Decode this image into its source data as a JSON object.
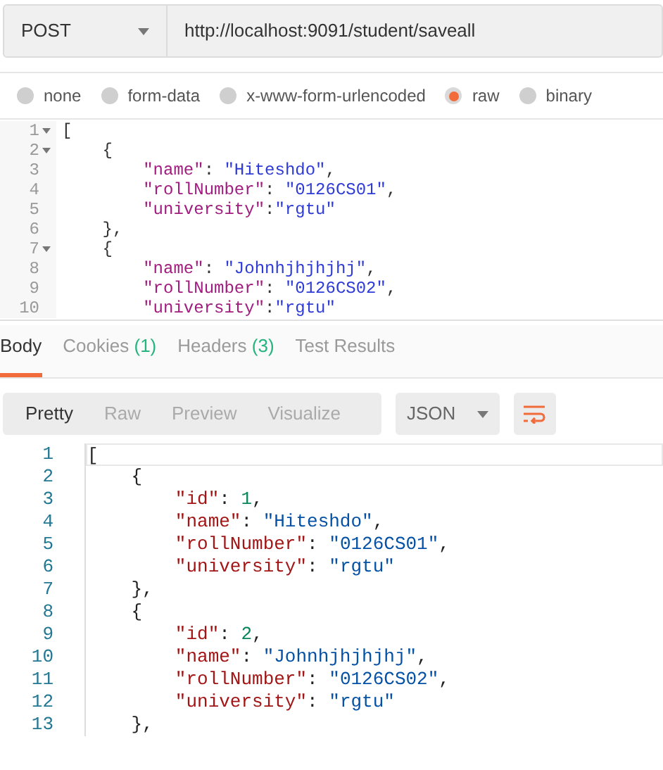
{
  "request": {
    "method": "POST",
    "url": "http://localhost:9091/student/saveall"
  },
  "body_types": [
    {
      "label": "none",
      "selected": false
    },
    {
      "label": "form-data",
      "selected": false
    },
    {
      "label": "x-www-form-urlencoded",
      "selected": false
    },
    {
      "label": "raw",
      "selected": true
    },
    {
      "label": "binary",
      "selected": false
    }
  ],
  "request_body": [
    {
      "number": "1",
      "fold": true,
      "tokens": [
        {
          "kind": "punct",
          "text": "["
        }
      ]
    },
    {
      "number": "2",
      "fold": true,
      "tokens": [
        {
          "kind": "punct",
          "text": "    {"
        }
      ]
    },
    {
      "number": "3",
      "fold": false,
      "tokens": [
        {
          "kind": "key",
          "text": "        \"name\""
        },
        {
          "kind": "punct",
          "text": ": "
        },
        {
          "kind": "string",
          "text": "\"Hiteshdo\""
        },
        {
          "kind": "punct",
          "text": ","
        }
      ]
    },
    {
      "number": "4",
      "fold": false,
      "tokens": [
        {
          "kind": "key",
          "text": "        \"rollNumber\""
        },
        {
          "kind": "punct",
          "text": ": "
        },
        {
          "kind": "string",
          "text": "\"0126CS01\""
        },
        {
          "kind": "punct",
          "text": ","
        }
      ]
    },
    {
      "number": "5",
      "fold": false,
      "tokens": [
        {
          "kind": "key",
          "text": "        \"university\""
        },
        {
          "kind": "punct",
          "text": ":"
        },
        {
          "kind": "string",
          "text": "\"rgtu\""
        }
      ]
    },
    {
      "number": "6",
      "fold": false,
      "tokens": [
        {
          "kind": "punct",
          "text": "    },"
        }
      ]
    },
    {
      "number": "7",
      "fold": true,
      "tokens": [
        {
          "kind": "punct",
          "text": "    {"
        }
      ]
    },
    {
      "number": "8",
      "fold": false,
      "tokens": [
        {
          "kind": "key",
          "text": "        \"name\""
        },
        {
          "kind": "punct",
          "text": ": "
        },
        {
          "kind": "string",
          "text": "\"Johnhjhjhjhj\""
        },
        {
          "kind": "punct",
          "text": ","
        }
      ]
    },
    {
      "number": "9",
      "fold": false,
      "tokens": [
        {
          "kind": "key",
          "text": "        \"rollNumber\""
        },
        {
          "kind": "punct",
          "text": ": "
        },
        {
          "kind": "string",
          "text": "\"0126CS02\""
        },
        {
          "kind": "punct",
          "text": ","
        }
      ]
    },
    {
      "number": "10",
      "fold": false,
      "tokens": [
        {
          "kind": "key",
          "text": "        \"university\""
        },
        {
          "kind": "punct",
          "text": ":"
        },
        {
          "kind": "string",
          "text": "\"rgtu\""
        }
      ]
    }
  ],
  "response_tabs": [
    {
      "label": "Body",
      "selected": true
    },
    {
      "label": "Cookies",
      "count": "(1)",
      "selected": false
    },
    {
      "label": "Headers",
      "count": "(3)",
      "selected": false
    },
    {
      "label": "Test Results",
      "selected": false
    }
  ],
  "view_modes": [
    {
      "label": "Pretty",
      "selected": true
    },
    {
      "label": "Raw",
      "selected": false
    },
    {
      "label": "Preview",
      "selected": false
    },
    {
      "label": "Visualize",
      "selected": false
    }
  ],
  "format": "JSON",
  "response_body": [
    {
      "number": "1",
      "tokens": [
        {
          "kind": "punct",
          "text": "["
        }
      ]
    },
    {
      "number": "2",
      "tokens": [
        {
          "kind": "punct",
          "text": "    {"
        }
      ]
    },
    {
      "number": "3",
      "tokens": [
        {
          "kind": "key",
          "text": "        \"id\""
        },
        {
          "kind": "punct",
          "text": ": "
        },
        {
          "kind": "number",
          "text": "1"
        },
        {
          "kind": "punct",
          "text": ","
        }
      ]
    },
    {
      "number": "4",
      "tokens": [
        {
          "kind": "key",
          "text": "        \"name\""
        },
        {
          "kind": "punct",
          "text": ": "
        },
        {
          "kind": "string",
          "text": "\"Hiteshdo\""
        },
        {
          "kind": "punct",
          "text": ","
        }
      ]
    },
    {
      "number": "5",
      "tokens": [
        {
          "kind": "key",
          "text": "        \"rollNumber\""
        },
        {
          "kind": "punct",
          "text": ": "
        },
        {
          "kind": "string",
          "text": "\"0126CS01\""
        },
        {
          "kind": "punct",
          "text": ","
        }
      ]
    },
    {
      "number": "6",
      "tokens": [
        {
          "kind": "key",
          "text": "        \"university\""
        },
        {
          "kind": "punct",
          "text": ": "
        },
        {
          "kind": "string",
          "text": "\"rgtu\""
        }
      ]
    },
    {
      "number": "7",
      "tokens": [
        {
          "kind": "punct",
          "text": "    },"
        }
      ]
    },
    {
      "number": "8",
      "tokens": [
        {
          "kind": "punct",
          "text": "    {"
        }
      ]
    },
    {
      "number": "9",
      "tokens": [
        {
          "kind": "key",
          "text": "        \"id\""
        },
        {
          "kind": "punct",
          "text": ": "
        },
        {
          "kind": "number",
          "text": "2"
        },
        {
          "kind": "punct",
          "text": ","
        }
      ]
    },
    {
      "number": "10",
      "tokens": [
        {
          "kind": "key",
          "text": "        \"name\""
        },
        {
          "kind": "punct",
          "text": ": "
        },
        {
          "kind": "string",
          "text": "\"Johnhjhjhjhj\""
        },
        {
          "kind": "punct",
          "text": ","
        }
      ]
    },
    {
      "number": "11",
      "tokens": [
        {
          "kind": "key",
          "text": "        \"rollNumber\""
        },
        {
          "kind": "punct",
          "text": ": "
        },
        {
          "kind": "string",
          "text": "\"0126CS02\""
        },
        {
          "kind": "punct",
          "text": ","
        }
      ]
    },
    {
      "number": "12",
      "tokens": [
        {
          "kind": "key",
          "text": "        \"university\""
        },
        {
          "kind": "punct",
          "text": ": "
        },
        {
          "kind": "string",
          "text": "\"rgtu\""
        }
      ]
    },
    {
      "number": "13",
      "tokens": [
        {
          "kind": "punct",
          "text": "    },"
        }
      ]
    }
  ]
}
